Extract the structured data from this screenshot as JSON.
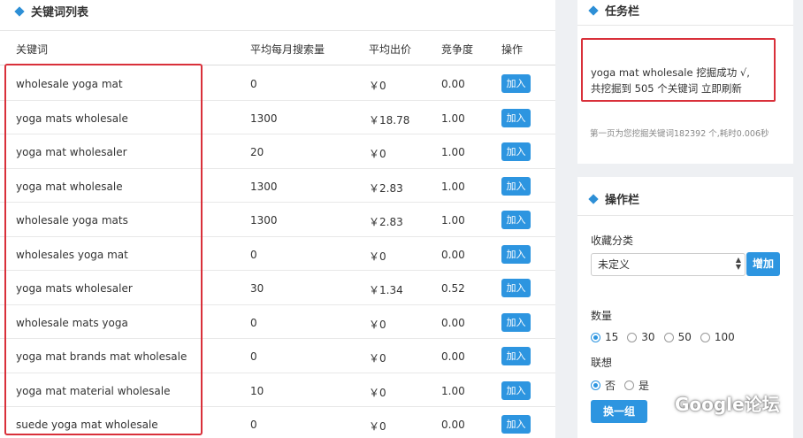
{
  "keywords_panel": {
    "title": "关键词列表",
    "headers": {
      "keyword": "关键词",
      "avg_searches": "平均每月搜索量",
      "avg_bid": "平均出价",
      "competition": "竞争度",
      "action": "操作"
    },
    "add_label": "加入",
    "rows": [
      {
        "keyword": "wholesale yoga mat",
        "searches": "0",
        "bid": "￥0",
        "competition": "0.00"
      },
      {
        "keyword": "yoga mats wholesale",
        "searches": "1300",
        "bid": "￥18.78",
        "competition": "1.00"
      },
      {
        "keyword": "yoga mat wholesaler",
        "searches": "20",
        "bid": "￥0",
        "competition": "1.00"
      },
      {
        "keyword": "yoga mat wholesale",
        "searches": "1300",
        "bid": "￥2.83",
        "competition": "1.00"
      },
      {
        "keyword": "wholesale yoga mats",
        "searches": "1300",
        "bid": "￥2.83",
        "competition": "1.00"
      },
      {
        "keyword": "wholesales yoga mat",
        "searches": "0",
        "bid": "￥0",
        "competition": "0.00"
      },
      {
        "keyword": "yoga mats wholesaler",
        "searches": "30",
        "bid": "￥1.34",
        "competition": "0.52"
      },
      {
        "keyword": "wholesale mats yoga",
        "searches": "0",
        "bid": "￥0",
        "competition": "0.00"
      },
      {
        "keyword": "yoga mat brands mat wholesale",
        "searches": "0",
        "bid": "￥0",
        "competition": "0.00"
      },
      {
        "keyword": "yoga mat material wholesale",
        "searches": "10",
        "bid": "￥0",
        "competition": "1.00"
      },
      {
        "keyword": "suede yoga mat wholesale",
        "searches": "0",
        "bid": "￥0",
        "competition": "0.00"
      }
    ]
  },
  "task_panel": {
    "title": "任务栏",
    "line1": "yoga mat wholesale 挖掘成功 √,",
    "line2": "共挖掘到 505 个关键词 立即刷新",
    "note": "第一页为您挖掘关键词182392 个,耗时0.006秒"
  },
  "operation_panel": {
    "title": "操作栏",
    "category_label": "收藏分类",
    "category_value": "未定义",
    "increase_label": "增加",
    "count_label": "数量",
    "count_options": [
      "15",
      "30",
      "50",
      "100"
    ],
    "count_selected": "15",
    "association_label": "联想",
    "association_options": [
      "否",
      "是"
    ],
    "association_selected": "否",
    "swap_label": "换一组"
  },
  "watermark": {
    "text": "Google论坛"
  },
  "colors": {
    "accent": "#2d95e0",
    "highlight": "#d9303a"
  }
}
